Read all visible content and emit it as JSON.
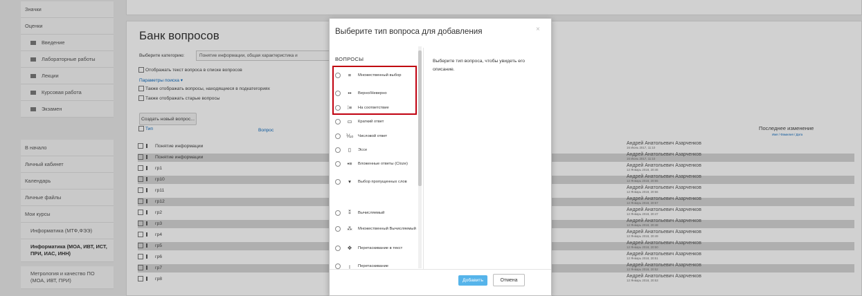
{
  "sidebar": {
    "items": [
      {
        "label": "Значки"
      },
      {
        "label": "Оценки"
      },
      {
        "label": "Введение"
      },
      {
        "label": "Лабораторные работы"
      },
      {
        "label": "Лекции"
      },
      {
        "label": "Курсовая работа"
      },
      {
        "label": "Экзамен"
      },
      {
        "label": "В начало"
      },
      {
        "label": "Личный кабинет"
      },
      {
        "label": "Календарь"
      },
      {
        "label": "Личные файлы"
      },
      {
        "label": "Мои курсы"
      },
      {
        "label": "Информатика (МТФ,ФЭЭ)"
      },
      {
        "label": "Информатика (МОА, ИВТ, ИСТ, ПРИ, ИАС, ИНН)"
      },
      {
        "label": "Метрология и качество ПО (МОА, ИВТ, ПРИ)"
      }
    ]
  },
  "main": {
    "title": "Банк вопросов",
    "category_label": "Выберите категорию:",
    "category_value": "Понятие информации, общая характеристика и",
    "show_text_label": "Отображать текст вопроса в списке вопросов",
    "search_params_link": "Параметры поиска",
    "subcategories_label": "Также отображать вопросы, находящиеся в подкатегориях",
    "old_questions_label": "Также отображать старые вопросы",
    "create_button": "Создать новый вопрос...",
    "col_type": "Тип",
    "col_question": "Вопрос",
    "col_last_modified": "Последнее изменение",
    "col_sort_hint": "Имя / Фамилия / Дата",
    "rows": [
      {
        "name": "Понятие информации",
        "author": "Андрей Анатольевич Азарченков",
        "date": "16 Июнь 2017, 11:10"
      },
      {
        "name": "Понятие информации",
        "author": "Андрей Анатольевич Азарченков",
        "date": "16 Июнь 2017, 11:10"
      },
      {
        "name": "гр1",
        "author": "Андрей Анатольевич Азарченков",
        "date": "12 Январь 2018, 20:46"
      },
      {
        "name": "гр10",
        "author": "Андрей Анатольевич Азарченков",
        "date": "12 Январь 2018, 20:55"
      },
      {
        "name": "гр11",
        "author": "Андрей Анатольевич Азарченков",
        "date": "12 Январь 2018, 20:56"
      },
      {
        "name": "гр12",
        "author": "Андрей Анатольевич Азарченков",
        "date": "12 Январь 2018, 20:57"
      },
      {
        "name": "гр2",
        "author": "Андрей Анатольевич Азарченков",
        "date": "12 Январь 2018, 20:47"
      },
      {
        "name": "гр3",
        "author": "Андрей Анатольевич Азарченков",
        "date": "12 Январь 2018, 20:48"
      },
      {
        "name": "гр4",
        "author": "Андрей Анатольевич Азарченков",
        "date": "12 Январь 2018, 20:49"
      },
      {
        "name": "гр5",
        "author": "Андрей Анатольевич Азарченков",
        "date": "12 Январь 2018, 20:50"
      },
      {
        "name": "гр6",
        "author": "Андрей Анатольевич Азарченков",
        "date": "12 Январь 2018, 20:51"
      },
      {
        "name": "гр7",
        "author": "Андрей Анатольевич Азарченков",
        "date": "12 Январь 2018, 20:52"
      },
      {
        "name": "гр8",
        "author": "Андрей Анатольевич Азарченков",
        "date": "12 Январь 2018, 20:53"
      }
    ]
  },
  "modal": {
    "title": "Выберите тип вопроса для добавления",
    "close": "×",
    "section_header": "ВОПРОСЫ",
    "description": "Выберите тип вопроса, чтобы увидеть его описание.",
    "options": [
      {
        "label": "Множественный выбор",
        "icon": "≡"
      },
      {
        "label": "Верно/Неверно",
        "icon": "••"
      },
      {
        "label": "На соответствие",
        "icon": "⁞≡"
      },
      {
        "label": "Краткий ответ",
        "icon": "▭"
      },
      {
        "label": "Числовой ответ",
        "icon": "⅒"
      },
      {
        "label": "Эссе",
        "icon": "▯"
      },
      {
        "label": "Вложенные ответы (Cloze)",
        "icon": "▪≡"
      },
      {
        "label": "Выбор пропущенных слов",
        "icon": "▾"
      },
      {
        "label": "Вычисляемый",
        "icon": "⁑"
      },
      {
        "label": "Множественный Вычисляемый",
        "icon": "⁂"
      },
      {
        "label": "Перетаскивание в текст",
        "icon": "✥"
      },
      {
        "label": "Перетаскивание",
        "icon": "↕"
      }
    ],
    "add_button": "Добавить",
    "cancel_button": "Отмена"
  }
}
